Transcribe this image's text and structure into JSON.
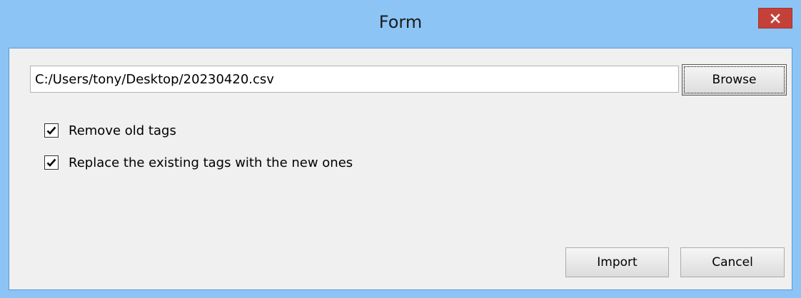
{
  "window": {
    "title": "Form"
  },
  "file": {
    "path_value": "C:/Users/tony/Desktop/20230420.csv"
  },
  "buttons": {
    "browse_label": "Browse",
    "import_label": "Import",
    "cancel_label": "Cancel",
    "close_icon": "close-icon"
  },
  "options": [
    {
      "label": "Remove old tags",
      "checked": true
    },
    {
      "label": "Replace the existing tags with the new ones",
      "checked": true
    }
  ],
  "colors": {
    "titlebar": "#8cc4f5",
    "close_button": "#c4413a",
    "client_background": "#f0f0f0"
  }
}
